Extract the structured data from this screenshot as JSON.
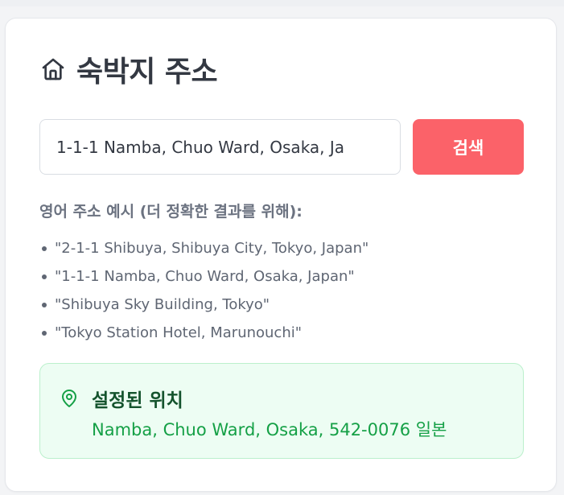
{
  "header": {
    "title": "숙박지 주소",
    "icon": "home-icon"
  },
  "search": {
    "value": "1-1-1 Namba, Chuo Ward, Osaka, Ja",
    "button_label": "검색"
  },
  "examples": {
    "title": "영어 주소 예시 (더 정확한 결과를 위해):",
    "items": [
      "\"2-1-1 Shibuya, Shibuya City, Tokyo, Japan\"",
      "\"1-1-1 Namba, Chuo Ward, Osaka, Japan\"",
      "\"Shibuya Sky Building, Tokyo\"",
      "\"Tokyo Station Hotel, Marunouchi\""
    ]
  },
  "location": {
    "title": "설정된 위치",
    "address": "Namba, Chuo Ward, Osaka, 542-0076 일본",
    "icon": "map-pin-icon"
  },
  "colors": {
    "accent": "#fb6269",
    "success_bg": "#edfdf3",
    "success_text": "#15a046",
    "success_title": "#14532d"
  }
}
